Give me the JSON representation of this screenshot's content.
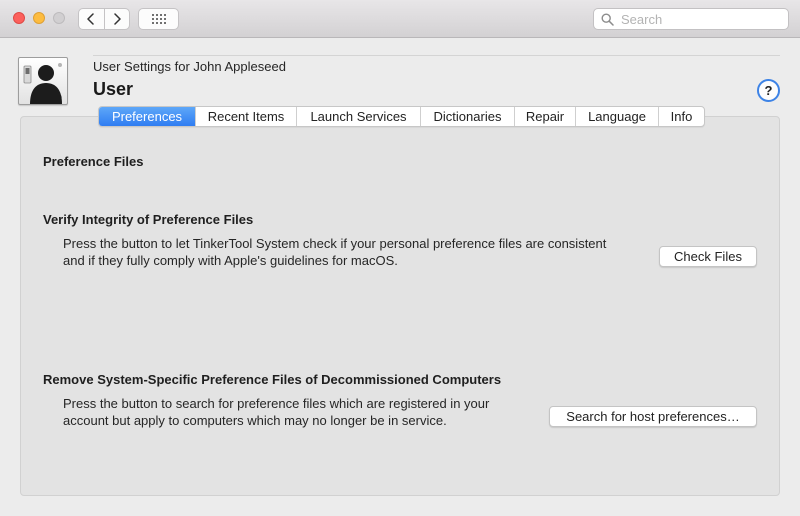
{
  "toolbar": {
    "search_placeholder": "Search",
    "icons": {
      "back": "chevron-left-icon",
      "forward": "chevron-right-icon",
      "show_all": "grid-icon",
      "search": "magnifier-icon"
    }
  },
  "header": {
    "subtitle": "User Settings for John Appleseed",
    "title": "User",
    "help_label": "?",
    "icon": "user-silhouette-switch-icon"
  },
  "tabs": [
    {
      "label": "Preferences",
      "active": true
    },
    {
      "label": "Recent Items",
      "active": false
    },
    {
      "label": "Launch Services",
      "active": false
    },
    {
      "label": "Dictionaries",
      "active": false
    },
    {
      "label": "Repair",
      "active": false
    },
    {
      "label": "Language",
      "active": false
    },
    {
      "label": "Info",
      "active": false
    }
  ],
  "content": {
    "heading": "Preference Files",
    "verify": {
      "title": "Verify Integrity of Preference Files",
      "lines": [
        "Press the button to let TinkerTool System check if your personal preference files are consistent",
        "and if they fully comply with Apple's guidelines for macOS."
      ],
      "button_label": "Check Files"
    },
    "remove": {
      "title": "Remove System-Specific Preference Files of Decommissioned Computers",
      "lines": [
        "Press the button to search for preference files which are registered in your",
        "account but apply to computers which may no longer be in service."
      ],
      "button_label": "Search for host preferences…"
    }
  },
  "colors": {
    "accent": "#2f7df2",
    "close": "#fc605c",
    "minimize": "#fdbc40",
    "zoom_disabled": "#d1cfd1"
  }
}
